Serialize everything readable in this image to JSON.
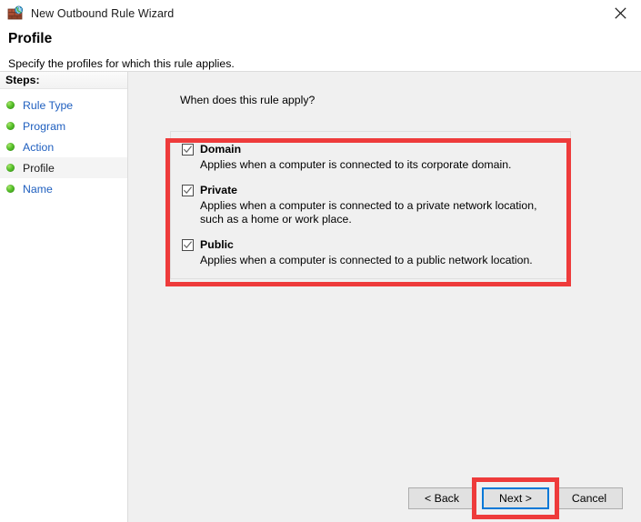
{
  "titlebar": {
    "icon": "firewall-globe-icon",
    "title": "New Outbound Rule Wizard",
    "close_label": "✕"
  },
  "header": {
    "title": "Profile",
    "subtitle": "Specify the profiles for which this rule applies."
  },
  "sidebar": {
    "heading": "Steps:",
    "items": [
      {
        "label": "Rule Type",
        "current": false
      },
      {
        "label": "Program",
        "current": false
      },
      {
        "label": "Action",
        "current": false
      },
      {
        "label": "Profile",
        "current": true
      },
      {
        "label": "Name",
        "current": false
      }
    ]
  },
  "main": {
    "question": "When does this rule apply?",
    "options": [
      {
        "label": "Domain",
        "checked": true,
        "description": "Applies when a computer is connected to its corporate domain."
      },
      {
        "label": "Private",
        "checked": true,
        "description": "Applies when a computer is connected to a private network location, such as a home or work place."
      },
      {
        "label": "Public",
        "checked": true,
        "description": "Applies when a computer is connected to a public network location."
      }
    ]
  },
  "buttons": {
    "back": "< Back",
    "next": "Next >",
    "cancel": "Cancel"
  },
  "annotations": {
    "color": "#ee3b3b",
    "focus_color": "#0078d7"
  }
}
